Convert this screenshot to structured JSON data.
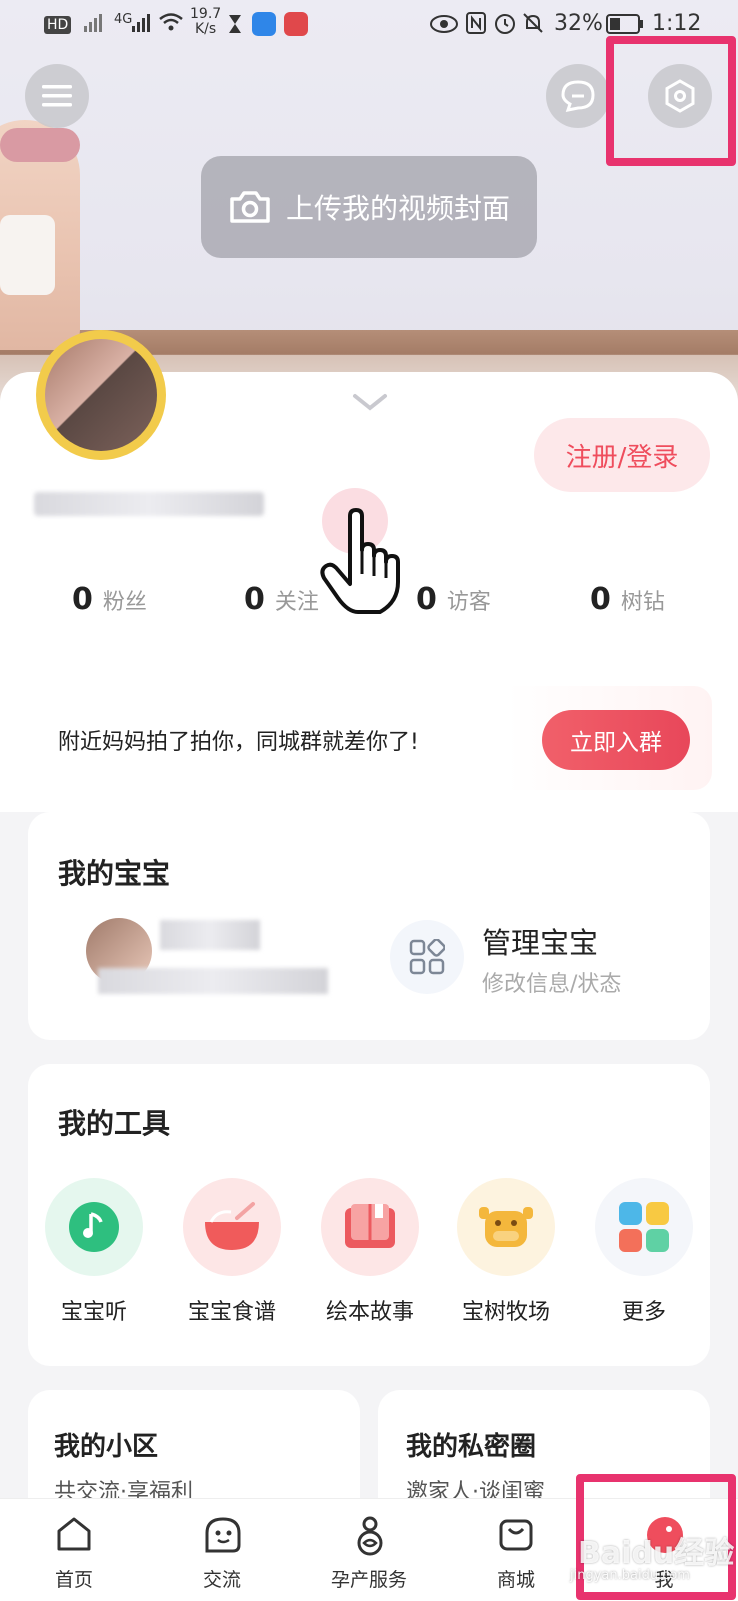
{
  "status_bar": {
    "network_badge": "HD",
    "signal": "4G",
    "speed": "19.7",
    "speed_unit": "K/s",
    "battery": "32%",
    "time": "1:12"
  },
  "header": {
    "upload_cover_label": "上传我的视频封面"
  },
  "profile": {
    "login_button": "注册/登录",
    "stats": [
      {
        "value": "0",
        "label": "粉丝"
      },
      {
        "value": "0",
        "label": "关注"
      },
      {
        "value": "0",
        "label": "访客"
      },
      {
        "value": "0",
        "label": "树钻"
      }
    ]
  },
  "group_banner": {
    "text": "附近妈妈拍了拍你，同城群就差你了!",
    "button": "立即入群"
  },
  "my_baby": {
    "title": "我的宝宝",
    "manage_title": "管理宝宝",
    "manage_subtitle": "修改信息/状态"
  },
  "my_tools": {
    "title": "我的工具",
    "items": [
      {
        "label": "宝宝听",
        "icon": "music-note-icon",
        "color": "#2ebf7f"
      },
      {
        "label": "宝宝食谱",
        "icon": "bowl-icon",
        "color": "#f05b5b"
      },
      {
        "label": "绘本故事",
        "icon": "book-icon",
        "color": "#ec5a5f"
      },
      {
        "label": "宝树牧场",
        "icon": "cow-icon",
        "color": "#f4b73c"
      },
      {
        "label": "更多",
        "icon": "grid-icon",
        "color": "#f3705a"
      }
    ]
  },
  "my_community": {
    "title": "我的小区",
    "subtitle": "共交流·享福利"
  },
  "my_circle": {
    "title": "我的私密圈",
    "subtitle": "邀家人·谈闺蜜"
  },
  "bottom_nav": {
    "items": [
      {
        "label": "首页",
        "icon": "home-icon"
      },
      {
        "label": "交流",
        "icon": "chat-ghost-icon"
      },
      {
        "label": "孕产服务",
        "icon": "pregnancy-icon"
      },
      {
        "label": "商城",
        "icon": "shop-bag-icon"
      },
      {
        "label": "我",
        "icon": "me-icon"
      }
    ]
  },
  "watermark": {
    "text": "Baidu经验",
    "sub": "jingyan.baidu.com"
  }
}
